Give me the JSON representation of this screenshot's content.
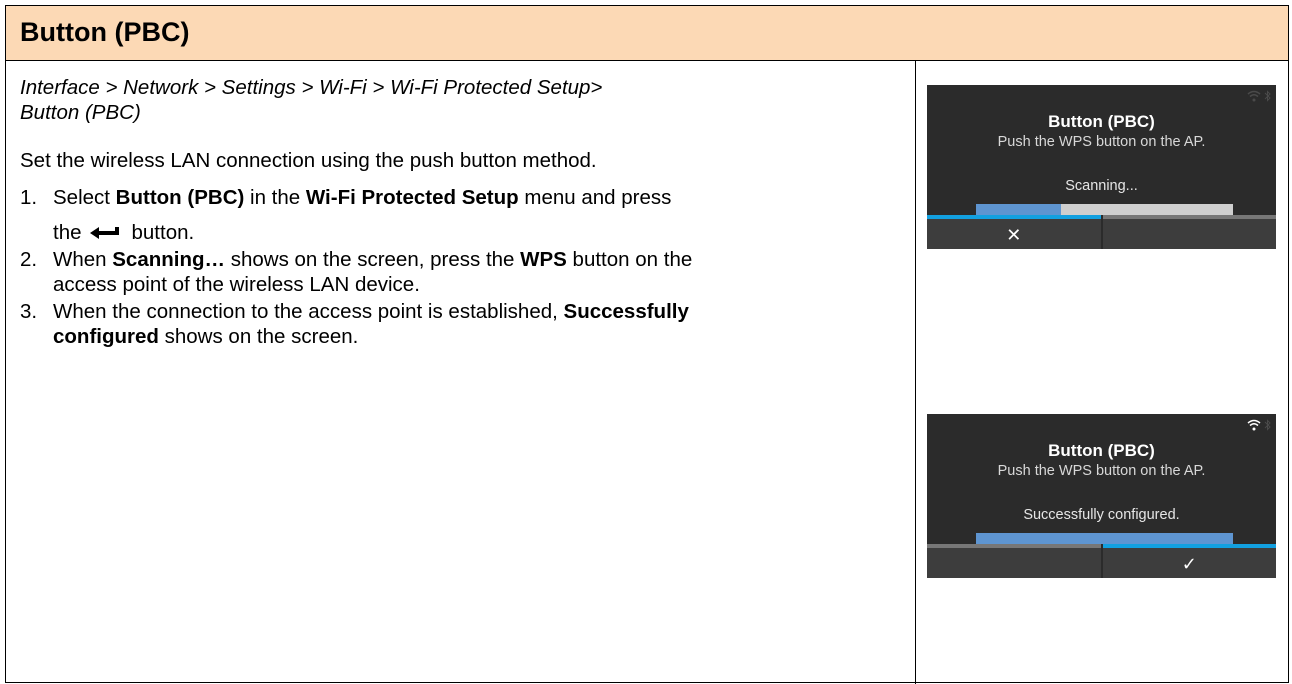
{
  "header": {
    "title": "Button (PBC)"
  },
  "breadcrumb": {
    "line1": "Interface > Network > Settings > Wi-Fi > Wi-Fi Protected Setup>",
    "line2": "Button (PBC)"
  },
  "intro": "Set the wireless LAN connection using the push button method.",
  "steps": [
    {
      "num": "1.",
      "t1": "Select ",
      "b1": "Button (PBC)",
      "t2": " in the ",
      "b2": "Wi-Fi Protected Setup",
      "t3": " menu and press",
      "t4": "the",
      "t5": "button.",
      "icon": "enter-arrow-icon"
    },
    {
      "num": "2.",
      "t1": "When ",
      "b1": "Scanning…",
      "t2": " shows on the screen, press the ",
      "b2": "WPS",
      "t3": " button on the",
      "t4": "access point of the wireless LAN device."
    },
    {
      "num": "3.",
      "t1": "When the connection to the access point is established, ",
      "b1": "Successfully",
      "b2": "configured",
      "t2": " shows on the screen."
    }
  ],
  "screens": [
    {
      "title": "Button (PBC)",
      "subtitle": "Push the WPS button on the AP.",
      "status": "Scanning...",
      "progress": 0.33,
      "left_key_icon": "close-icon",
      "left_key_glyph": "✕",
      "right_key_glyph": "",
      "active_key": "left",
      "wifi_icon_color": "#4a4a4a"
    },
    {
      "title": "Button (PBC)",
      "subtitle": "Push the WPS button on the AP.",
      "status": "Successfully configured.",
      "progress": 1.0,
      "left_key_glyph": "",
      "right_key_icon": "checkmark-icon",
      "right_key_glyph": "✓",
      "active_key": "right",
      "wifi_icon_color": "#ffffff"
    }
  ],
  "colors": {
    "header_bg": "#fcd9b5",
    "screen_bg": "#2b2b2b",
    "progress_fill": "#5e95d1",
    "progress_track": "#cfcfcf",
    "softkey_active": "#12a0e0"
  }
}
